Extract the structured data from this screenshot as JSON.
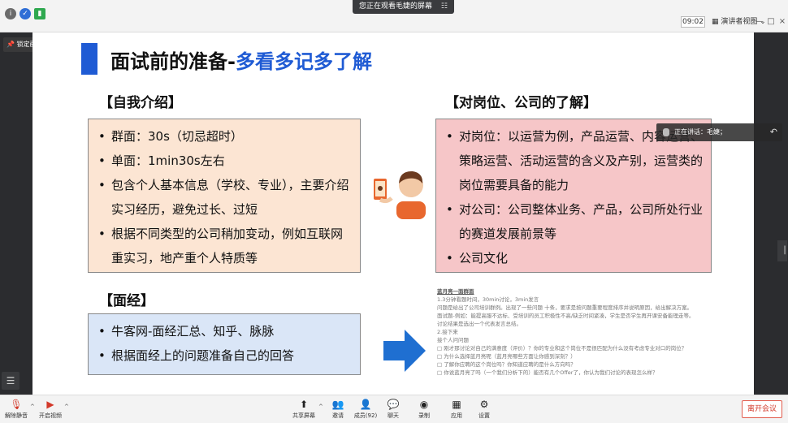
{
  "topbar": {
    "viewing_banner": "您正在观看毛婕的屏幕",
    "banner_menu": "☷",
    "time": "09:02",
    "view_mode": "演讲者视图",
    "icons": [
      "info-icon",
      "shield-icon",
      "signal-icon"
    ]
  },
  "pin_label": "锁定画面",
  "slide": {
    "title_main": "面试前的准备-",
    "title_highlight": "多看多记多了解",
    "self_intro": {
      "heading": "【自我介绍】",
      "items": [
        "群面：30s（切忌超时）",
        "单面：1min30s左右",
        "包含个人基本信息（学校、专业），主要介绍实习经历，避免过长、过短",
        "根据不同类型的公司稍加变动，例如互联网重实习，地产重个人特质等"
      ]
    },
    "job_company": {
      "heading": "【对岗位、公司的了解】",
      "items": [
        "对岗位：以运营为例，产品运营、内容运营、策略运营、活动运营的含义及产别，运营类的岗位需要具备的能力",
        "对公司：公司整体业务、产品，公司所处行业的赛道发展前景等",
        "公司文化"
      ]
    },
    "interview": {
      "heading": "【面经】",
      "items": [
        "牛客网-面经汇总、知乎、脉脉",
        "根据面经上的问题准备自己的回答"
      ]
    },
    "doc_preview": {
      "heading": "蓝月亮一面群面",
      "lines": [
        "1.3分钟看题时间，30min讨论，3min发言",
        "问题是给出了公司培训群例。出现了一些问题 十条，要求是按问题重要程度排序并说明原因，给出解决方案。",
        "面试题-例如：能提高服不达标、受培训的员工积极性不高/缺乏时间紧凑，学生是否学生再开课安备能理走等。",
        "讨论结果是选出一个代表发言总结。",
        "2.接下来",
        "接个人问问题",
        "□ 刚才那讨论对自己的满意度（评价）？你的专业和这个岗位不是很匹配为什么没有考虑专业对口的岗位？",
        "□ 为什么选择蓝月亮呢（蓝月亮哪些方面让你感到深刻？）",
        "□ 了解你应聘的这个岗位吗？你知道应聘的是什么方向吗？",
        "□ 你说蓝月亮了吗（一个我们分析下的）能否有几个Offer了，你认为我们讨论的表现怎么样？"
      ]
    }
  },
  "discussion_label": "正在讲话：毛婕；",
  "toolbar": {
    "mute": "解除静音",
    "video": "开启视频",
    "share": "共享屏幕",
    "invite": "邀请",
    "members": "成员(92)",
    "chat": "聊天",
    "record": "录制",
    "apps": "应用",
    "settings": "设置",
    "leave": "离开会议"
  }
}
